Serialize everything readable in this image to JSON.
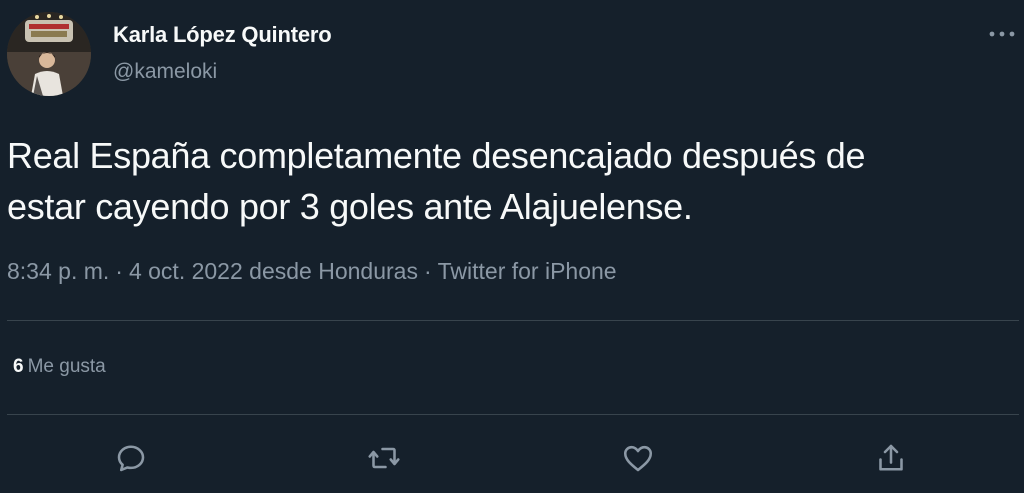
{
  "author": {
    "display_name": "Karla López Quintero",
    "handle": "@kameloki"
  },
  "tweet": {
    "text_lines": [
      "Real España completamente desencajado después de",
      "estar cayendo por 3 goles ante Alajuelense."
    ],
    "time": "8:34 p. m.",
    "date": "4 oct. 2022",
    "location": "desde Honduras",
    "source": "Twitter for iPhone",
    "separator": "·"
  },
  "stats": {
    "likes_count": "6",
    "likes_label": "Me gusta"
  },
  "actions": [
    {
      "icon": "reply-icon"
    },
    {
      "icon": "retweet-icon"
    },
    {
      "icon": "like-icon"
    },
    {
      "icon": "share-icon"
    }
  ],
  "icons": {
    "more": "more-options-icon"
  },
  "colors": {
    "background": "#15202b",
    "primary_text": "#f7f9f9",
    "secondary_text": "#8b98a5",
    "divider": "#38444d"
  }
}
